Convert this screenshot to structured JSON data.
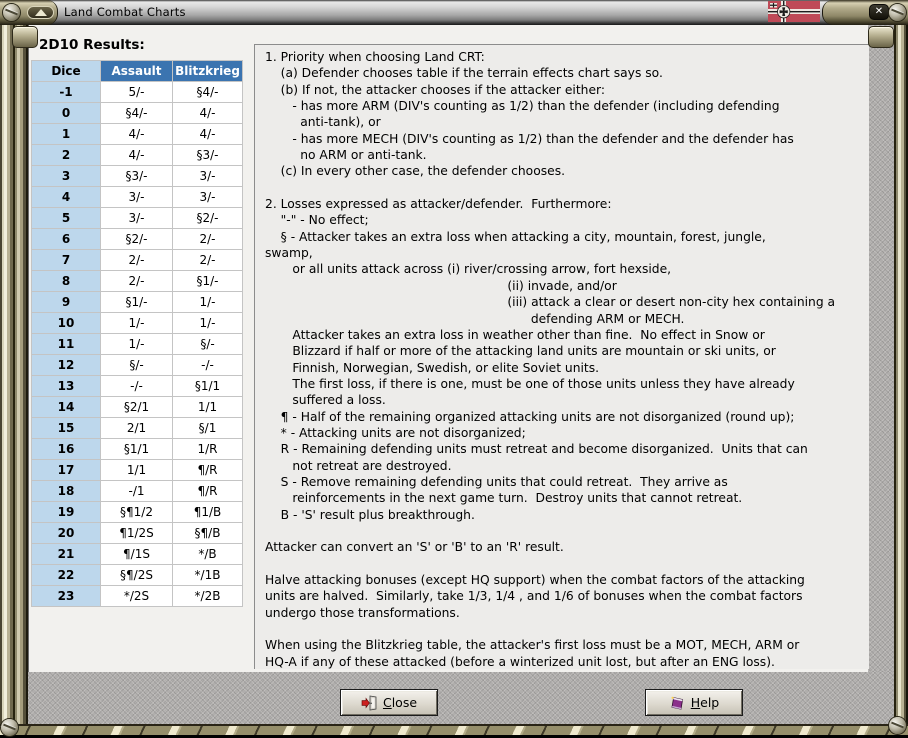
{
  "window": {
    "title": "Land Combat Charts",
    "close_glyph": "✕"
  },
  "heading": "2D10 Results:",
  "table": {
    "columns": [
      "Dice",
      "Assault",
      "Blitzkrieg"
    ],
    "rows": [
      [
        "-1",
        "5/-",
        "§4/-"
      ],
      [
        "0",
        "§4/-",
        "4/-"
      ],
      [
        "1",
        "4/-",
        "4/-"
      ],
      [
        "2",
        "4/-",
        "§3/-"
      ],
      [
        "3",
        "§3/-",
        "3/-"
      ],
      [
        "4",
        "3/-",
        "3/-"
      ],
      [
        "5",
        "3/-",
        "§2/-"
      ],
      [
        "6",
        "§2/-",
        "2/-"
      ],
      [
        "7",
        "2/-",
        "2/-"
      ],
      [
        "8",
        "2/-",
        "§1/-"
      ],
      [
        "9",
        "§1/-",
        "1/-"
      ],
      [
        "10",
        "1/-",
        "1/-"
      ],
      [
        "11",
        "1/-",
        "§/-"
      ],
      [
        "12",
        "§/-",
        "-/-"
      ],
      [
        "13",
        "-/-",
        "§1/1"
      ],
      [
        "14",
        "§2/1",
        "1/1"
      ],
      [
        "15",
        "2/1",
        "§/1"
      ],
      [
        "16",
        "§1/1",
        "1/R"
      ],
      [
        "17",
        "1/1",
        "¶/R"
      ],
      [
        "18",
        "-/1",
        "¶/R"
      ],
      [
        "19",
        "§¶1/2",
        "¶1/B"
      ],
      [
        "20",
        "¶1/2S",
        "§¶/B"
      ],
      [
        "21",
        "¶/1S",
        "*/B"
      ],
      [
        "22",
        "§¶/2S",
        "*/1B"
      ],
      [
        "23",
        "*/2S",
        "*/2B"
      ]
    ]
  },
  "notes_lines": [
    "1. Priority when choosing Land CRT:",
    "    (a) Defender chooses table if the terrain effects chart says so.",
    "    (b) If not, the attacker chooses if the attacker either:",
    "       - has more ARM (DIV's counting as 1/2) than the defender (including defending",
    "         anti-tank), or",
    "       - has more MECH (DIV's counting as 1/2) than the defender and the defender has",
    "         no ARM or anti-tank.",
    "    (c) In every other case, the defender chooses.",
    "",
    "2. Losses expressed as attacker/defender.  Furthermore:",
    "    \"-\" - No effect;",
    "    § - Attacker takes an extra loss when attacking a city, mountain, forest, jungle,",
    "swamp,",
    "       or all units attack across (i) river/crossing arrow, fort hexside,",
    "                                                              (ii) invade, and/or",
    "                                                              (iii) attack a clear or desert non-city hex containing a",
    "                                                                    defending ARM or MECH.",
    "       Attacker takes an extra loss in weather other than fine.  No effect in Snow or",
    "       Blizzard if half or more of the attacking land units are mountain or ski units, or",
    "       Finnish, Norwegian, Swedish, or elite Soviet units.",
    "       The first loss, if there is one, must be one of those units unless they have already",
    "       suffered a loss.",
    "    ¶ - Half of the remaining organized attacking units are not disorganized (round up);",
    "    * - Attacking units are not disorganized;",
    "    R - Remaining defending units must retreat and become disorganized.  Units that can",
    "       not retreat are destroyed.",
    "    S - Remove remaining defending units that could retreat.  They arrive as",
    "       reinforcements in the next game turn.  Destroy units that cannot retreat.",
    "    B - 'S' result plus breakthrough.",
    "",
    "Attacker can convert an 'S' or 'B' to an 'R' result.",
    "",
    "Halve attacking bonuses (except HQ support) when the combat factors of the attacking",
    "units are halved.  Similarly, take 1/3, 1/4 , and 1/6 of bonuses when the combat factors",
    "undergo those transformations.",
    "",
    "When using the Blitzkrieg table, the attacker's first loss must be a MOT, MECH, ARM or",
    "HQ-A if any of these attacked (before a winterized unit lost, but after an ENG loss)."
  ],
  "buttons": {
    "close": "Close",
    "help": "Help"
  },
  "colors": {
    "header_blue": "#3b74b0",
    "dice_blue": "#bdd7ec",
    "flag_red": "#bf4a57",
    "frame_tan": "#a59d7d",
    "panel_bg": "#edecea",
    "content_bg": "#f2f1ee"
  }
}
